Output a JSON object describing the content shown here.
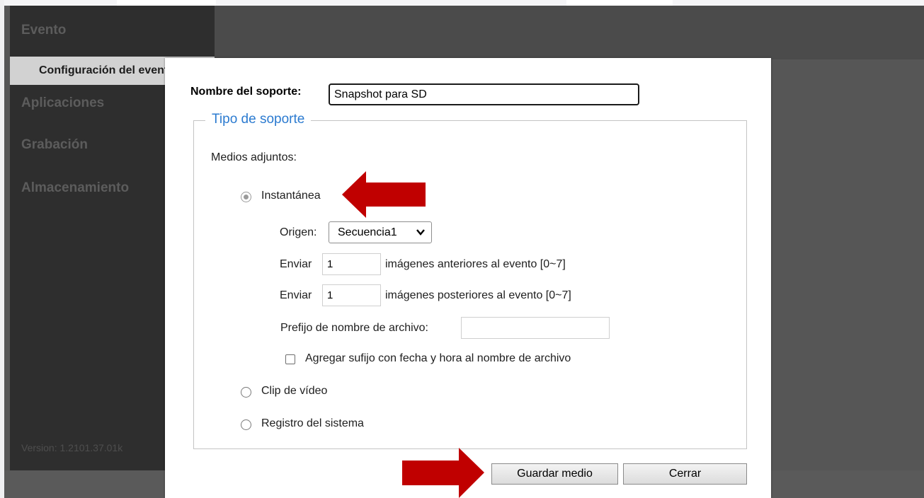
{
  "sidebar": {
    "items": [
      {
        "label": "Evento"
      },
      {
        "label": "Aplicaciones"
      },
      {
        "label": "Grabación"
      },
      {
        "label": "Almacenamiento"
      }
    ],
    "subitem_label": "Configuración del evento",
    "version": "Version: 1.2101.37.01k"
  },
  "dialog": {
    "name_label": "Nombre del soporte:",
    "name_value": "Snapshot para SD",
    "legend": "Tipo de soporte",
    "attached_label": "Medios adjuntos:",
    "options": {
      "snapshot": "Instantánea",
      "clip": "Clip de vídeo",
      "syslog": "Registro del sistema"
    },
    "selected_option": "snapshot",
    "origin_label": "Origen:",
    "origin_value": "Secuencia1",
    "send_label": "Enviar",
    "pre_value": "1",
    "pre_suffix": "imágenes anteriores al evento [0~7]",
    "post_value": "1",
    "post_suffix": "imágenes posteriores al evento [0~7]",
    "prefix_label": "Prefijo de nombre de archivo:",
    "prefix_value": "",
    "date_suffix_label": "Agregar sufijo con fecha y hora al nombre de archivo",
    "date_suffix_checked": false,
    "save_button": "Guardar medio",
    "close_button": "Cerrar"
  },
  "colors": {
    "accent": "#2c7bd0",
    "annotation_arrow": "#c00000",
    "sidebar_bg": "#2e2e2e"
  },
  "icons": [
    "chevron-down-icon",
    "arrow-left-icon",
    "arrow-right-icon"
  ]
}
